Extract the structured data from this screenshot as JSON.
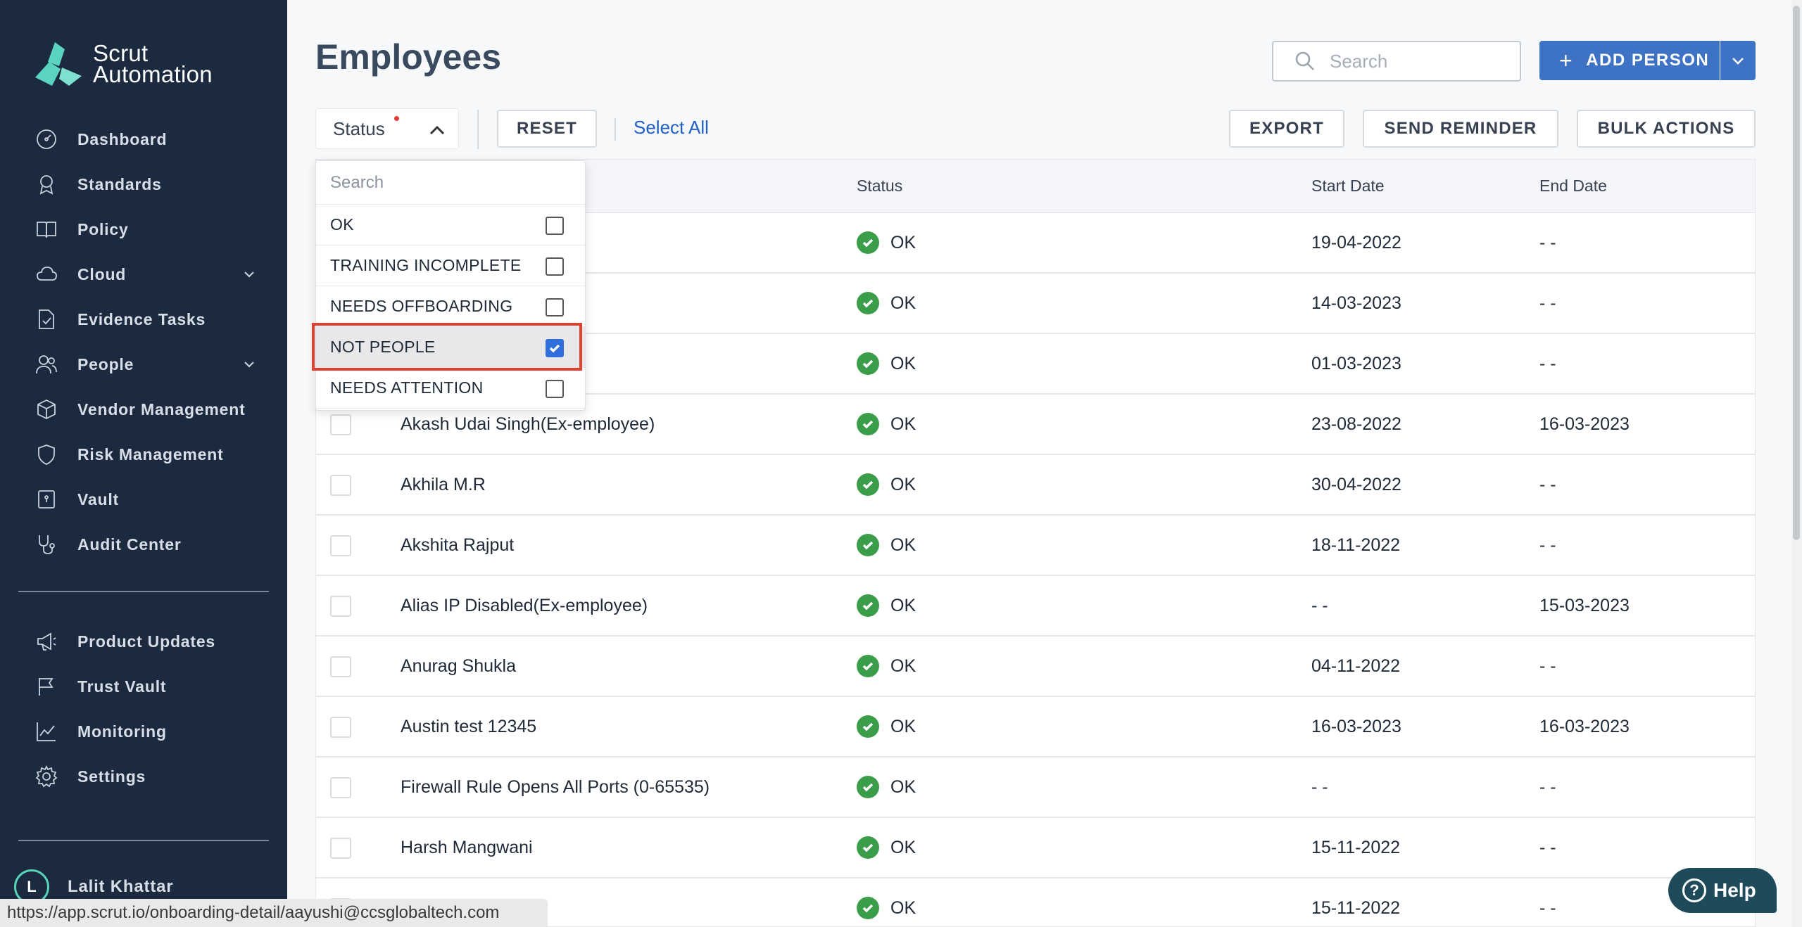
{
  "brand": {
    "line1": "Scrut",
    "line2": "Automation"
  },
  "sidebar": {
    "items": [
      {
        "label": "Dashboard",
        "icon": "dashboard-icon"
      },
      {
        "label": "Standards",
        "icon": "award-icon"
      },
      {
        "label": "Policy",
        "icon": "book-icon"
      },
      {
        "label": "Cloud",
        "icon": "cloud-icon",
        "has_chevron": true
      },
      {
        "label": "Evidence Tasks",
        "icon": "file-check-icon"
      },
      {
        "label": "People",
        "icon": "users-icon",
        "has_chevron": true
      },
      {
        "label": "Vendor Management",
        "icon": "box-icon"
      },
      {
        "label": "Risk Management",
        "icon": "shield-icon"
      },
      {
        "label": "Vault",
        "icon": "vault-icon"
      },
      {
        "label": "Audit Center",
        "icon": "stethoscope-icon"
      }
    ],
    "bottom_items": [
      {
        "label": "Product Updates",
        "icon": "megaphone-icon"
      },
      {
        "label": "Trust Vault",
        "icon": "flag-icon"
      },
      {
        "label": "Monitoring",
        "icon": "chart-line-icon"
      },
      {
        "label": "Settings",
        "icon": "gear-icon"
      }
    ],
    "user": {
      "initial": "L",
      "name": "Lalit Khattar"
    }
  },
  "header": {
    "title": "Employees",
    "search_placeholder": "Search",
    "add_person_label": "ADD PERSON"
  },
  "toolbar": {
    "status_label": "Status",
    "reset_label": "RESET",
    "select_all_label": "Select All",
    "export_label": "EXPORT",
    "send_reminder_label": "SEND REMINDER",
    "bulk_actions_label": "BULK ACTIONS"
  },
  "status_dropdown": {
    "search_placeholder": "Search",
    "options": [
      {
        "label": "OK",
        "checked": false
      },
      {
        "label": "TRAINING INCOMPLETE",
        "checked": false
      },
      {
        "label": "NEEDS OFFBOARDING",
        "checked": false
      },
      {
        "label": "NOT PEOPLE",
        "checked": true
      },
      {
        "label": "NEEDS ATTENTION",
        "checked": false
      }
    ]
  },
  "table": {
    "columns": {
      "status": "Status",
      "start_date": "Start Date",
      "end_date": "End Date"
    },
    "rows": [
      {
        "name": "",
        "status": "OK",
        "start_date": "19-04-2022",
        "end_date": "- -"
      },
      {
        "name": "",
        "status": "OK",
        "start_date": "14-03-2023",
        "end_date": "- -"
      },
      {
        "name": "",
        "status": "OK",
        "start_date": "01-03-2023",
        "end_date": "- -"
      },
      {
        "name": "Akash Udai Singh(Ex-employee)",
        "status": "OK",
        "start_date": "23-08-2022",
        "end_date": "16-03-2023"
      },
      {
        "name": "Akhila M.R",
        "status": "OK",
        "start_date": "30-04-2022",
        "end_date": "- -"
      },
      {
        "name": "Akshita Rajput",
        "status": "OK",
        "start_date": "18-11-2022",
        "end_date": "- -"
      },
      {
        "name": "Alias IP Disabled(Ex-employee)",
        "status": "OK",
        "start_date": "- -",
        "end_date": "15-03-2023"
      },
      {
        "name": "Anurag Shukla",
        "status": "OK",
        "start_date": "04-11-2022",
        "end_date": "- -"
      },
      {
        "name": "Austin test 12345",
        "status": "OK",
        "start_date": "16-03-2023",
        "end_date": "16-03-2023"
      },
      {
        "name": "Firewall Rule Opens All Ports (0-65535)",
        "status": "OK",
        "start_date": "- -",
        "end_date": "- -"
      },
      {
        "name": "Harsh Mangwani",
        "status": "OK",
        "start_date": "15-11-2022",
        "end_date": "- -"
      },
      {
        "name": "",
        "status": "OK",
        "start_date": "15-11-2022",
        "end_date": "- -"
      }
    ]
  },
  "status_bar": {
    "url": "https://app.scrut.io/onboarding-detail/aayushi@ccsglobaltech.com"
  },
  "help": {
    "label": "Help"
  },
  "colors": {
    "sidebar_bg": "#1c2a3f",
    "primary": "#3d72c4",
    "ok_green": "#3a9d4a",
    "highlight_red": "#e0412e",
    "link_blue": "#1f5fc4"
  }
}
